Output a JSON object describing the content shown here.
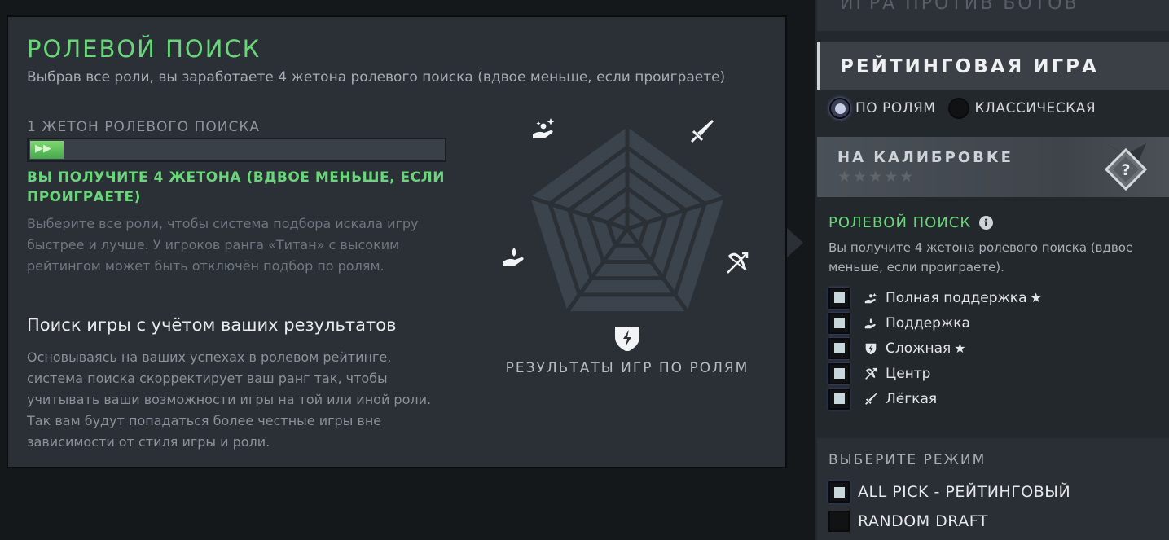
{
  "tooltip": {
    "title": "РОЛЕВОЙ ПОИСК",
    "subtitle": "Выбрав все роли, вы заработаете 4 жетона ролевого поиска (вдвое меньше, если проиграете)",
    "token_label": "1 ЖЕТОН РОЛЕВОГО ПОИСКА",
    "token_progress": 0.08,
    "green_message": "ВЫ ПОЛУЧИТЕ 4 ЖЕТОНА (ВДВОЕ МЕНЬШЕ, ЕСЛИ ПРОИГРАЕТЕ)",
    "grey_message": "Выберите все роли, чтобы система подбора искала игру быстрее и лучше. У игроков ранга «Титан» с высоким рейтингом может быть отключён подбор по ролям.",
    "section_title": "Поиск игры с учётом ваших результатов",
    "section_body": "Основываясь на ваших успехах в ролевом рейтинге, система поиска скорректирует ваш ранг так, чтобы учитывать ваши возможности игры на той или иной роли. Так вам будут попадаться более честные игры вне зависимости от стиля игры и роли.",
    "radar_caption": "РЕЗУЛЬТАТЫ ИГР ПО РОЛЯМ",
    "radar_icons": [
      "hard-support-icon",
      "carry-sword-icon",
      "mid-bow-icon",
      "offlane-shield-icon",
      "support-hand-icon"
    ]
  },
  "right_panel": {
    "bots_label": "ИГРА ПРОТИВ БОТОВ",
    "ranked_label": "РЕЙТИНГОВАЯ ИГРА",
    "radio_roles": "ПО РОЛЯМ",
    "radio_classic": "КЛАССИЧЕСКАЯ",
    "calibration_title": "НА КАЛИБРОВКЕ",
    "calibration_stars": "★★★★★",
    "calibration_badge": "?",
    "role_title": "РОЛЕВОЙ ПОИСК",
    "role_desc": "Вы получите 4 жетона ролевого поиска (вдвое меньше, если проиграете).",
    "roles": [
      {
        "label": "Полная поддержка",
        "icon": "hard-support-icon",
        "star": "★"
      },
      {
        "label": "Поддержка",
        "icon": "support-hand-icon",
        "star": ""
      },
      {
        "label": "Сложная",
        "icon": "offlane-shield-icon",
        "star": "★"
      },
      {
        "label": "Центр",
        "icon": "mid-bow-icon",
        "star": ""
      },
      {
        "label": "Лёгкая",
        "icon": "carry-sword-icon",
        "star": ""
      }
    ],
    "mode_title": "ВЫБЕРИТЕ РЕЖИМ",
    "modes": [
      {
        "label": "ALL PICK - РЕЙТИНГОВЫЙ",
        "checked": true
      },
      {
        "label": "RANDOM DRAFT",
        "checked": false
      }
    ]
  },
  "colors": {
    "accent_green": "#6ad67a",
    "panel": "#2b3036",
    "radar_fill": "#3b444c",
    "radar_lines": "#2b3036"
  }
}
